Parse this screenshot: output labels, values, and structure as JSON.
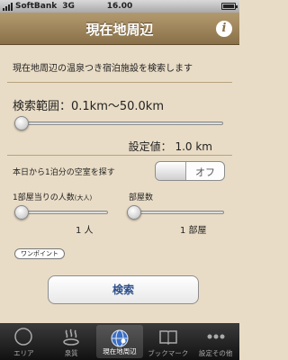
{
  "status_bar": {
    "carrier": "SoftBank",
    "network": "3G",
    "time": "16.00"
  },
  "nav": {
    "title": "現在地周辺",
    "info_icon": "i"
  },
  "content": {
    "description": "現在地周辺の温泉つき宿泊施設を検索します",
    "search_range_label": "検索範囲：0.1km〜50.0km",
    "range_slider_fraction": 0.02,
    "setting_value": "設定値： 1.0  km",
    "vacancy_label": "本日から1泊分の空室を探す",
    "vacancy_toggle": "オフ",
    "people_label": "1部屋当りの人数",
    "people_label_suffix": "(大人)",
    "people_value": "1 人",
    "rooms_label": "部屋数",
    "rooms_value": "1 部屋",
    "onepoint_button": "ワンポイント",
    "search_button": "検索"
  },
  "colors": {
    "background": "#e9dcc6",
    "nav": "#9c8358",
    "accent": "#4d7cd6",
    "tabbar": "#1e1e1e"
  },
  "tabs": [
    {
      "label": "エリア",
      "icon": "compass-icon",
      "active": false
    },
    {
      "label": "泉質",
      "icon": "hot-spring-icon",
      "active": false
    },
    {
      "label": "現在地周辺",
      "icon": "globe-location-icon",
      "active": true
    },
    {
      "label": "ブックマーク",
      "icon": "book-icon",
      "active": false
    },
    {
      "label": "設定その他",
      "icon": "more-icon",
      "active": false
    }
  ]
}
